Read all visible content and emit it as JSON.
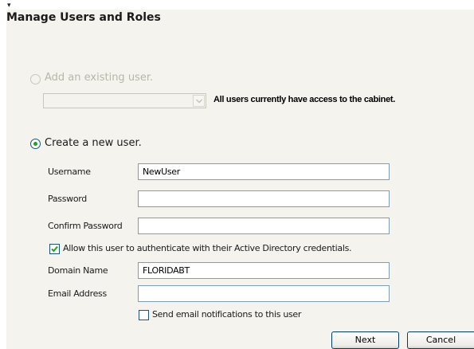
{
  "header": {
    "tick": "▾",
    "title": "Manage Users and Roles"
  },
  "existing_user": {
    "radio_label": "Add an existing user.",
    "selected": false,
    "disabled": true,
    "dropdown_value": "",
    "info": "All users currently have access to the cabinet."
  },
  "new_user": {
    "radio_label": "Create a new user.",
    "selected": true
  },
  "form": {
    "username_label": "Username",
    "username_value": "NewUser",
    "password_label": "Password",
    "password_value": "",
    "confirm_label": "Confirm Password",
    "confirm_value": "",
    "ad_auth_label": "Allow this user to authenticate with their Active Directory credentials.",
    "ad_auth_checked": true,
    "domain_label": "Domain Name",
    "domain_value": "FLORIDABT",
    "email_label": "Email Address",
    "email_value": "",
    "notify_label": "Send email notifications to this user",
    "notify_checked": false
  },
  "buttons": {
    "next": "Next",
    "cancel": "Cancel"
  },
  "colors": {
    "panel_bg": "#f4f3ee",
    "input_border": "#7f9db9",
    "radio_dot": "#21a121",
    "check_mark": "#21a121",
    "button_border": "#003c74"
  }
}
